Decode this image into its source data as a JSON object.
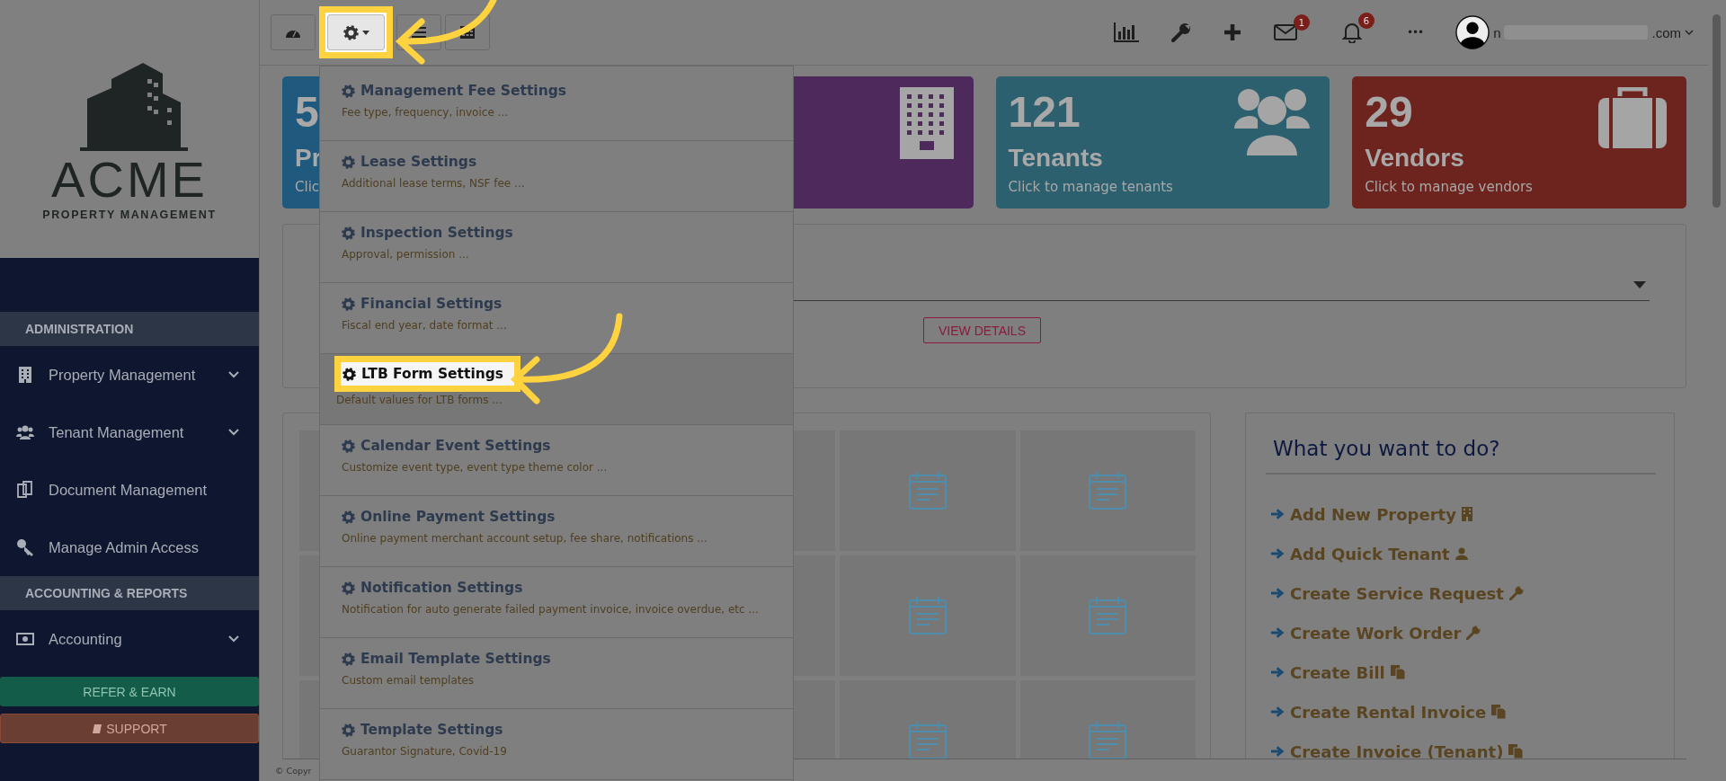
{
  "logo": {
    "name": "ACME",
    "tagline": "PROPERTY MANAGEMENT"
  },
  "sidebar": {
    "sections": [
      {
        "title": "ADMINISTRATION",
        "items": [
          {
            "label": "Property Management",
            "kind": "building",
            "expandable": true
          },
          {
            "label": "Tenant Management",
            "kind": "users",
            "expandable": true
          },
          {
            "label": "Document Management",
            "kind": "documents",
            "expandable": false
          },
          {
            "label": "Manage Admin Access",
            "kind": "key",
            "expandable": false
          }
        ]
      },
      {
        "title": "ACCOUNTING & REPORTS",
        "items": [
          {
            "label": "Accounting",
            "kind": "money",
            "expandable": true
          }
        ]
      }
    ],
    "refer_button": "REFER & EARN",
    "support_button": "SUPPORT"
  },
  "toolbar": {
    "buttons": [
      {
        "kind": "dashboard",
        "selected": false
      },
      {
        "kind": "settings",
        "selected": true
      },
      {
        "kind": "list",
        "selected": false
      },
      {
        "kind": "calculator",
        "selected": false
      }
    ]
  },
  "header": {
    "mail_badge": "1",
    "notification_badge": "6",
    "more": "•••",
    "email_start": "n",
    "email_end": ".com"
  },
  "cards": [
    {
      "kind": "properties",
      "number": "5",
      "label": "Pr",
      "subtitle": "Clic",
      "color": "#1f5a7e"
    },
    {
      "kind": "buildings",
      "color": "#4d2a5b"
    },
    {
      "kind": "tenants",
      "number": "121",
      "label": "Tenants",
      "subtitle": "Click to manage tenants",
      "color": "#2c606f"
    },
    {
      "kind": "vendors",
      "number": "29",
      "label": "Vendors",
      "subtitle": "Click to manage vendors",
      "color": "#6e241e"
    }
  ],
  "panel": {
    "view_details": "VIEW DETAILS"
  },
  "settings_menu": [
    {
      "title": "Management Fee Settings",
      "description": "Fee type, frequency, invoice ...",
      "selected": false
    },
    {
      "title": "Lease Settings",
      "description": "Additional lease terms, NSF fee ...",
      "selected": false
    },
    {
      "title": "Inspection Settings",
      "description": "Approval, permission ...",
      "selected": false
    },
    {
      "title": "Financial Settings",
      "description": "Fiscal end year, date format ...",
      "selected": false
    },
    {
      "title": "LTB Form Settings",
      "description": "Default values for LTB forms ...",
      "selected": true
    },
    {
      "title": "Calendar Event Settings",
      "description": "Customize event type, event type theme color ...",
      "selected": false
    },
    {
      "title": "Online Payment Settings",
      "description": "Online payment merchant account setup, fee share, notifications ...",
      "selected": false
    },
    {
      "title": "Notification Settings",
      "description": "Notification for auto generate failed payment invoice, invoice overdue, etc ...",
      "selected": false
    },
    {
      "title": "Email Template Settings",
      "description": "Custom email templates",
      "selected": false
    },
    {
      "title": "Template Settings",
      "description": "Guarantor Signature, Covid-19",
      "selected": false
    }
  ],
  "quick_actions": {
    "title": "What you want to do?",
    "items": [
      {
        "label": "Add New Property",
        "kind": "building"
      },
      {
        "label": "Add Quick Tenant",
        "kind": "user"
      },
      {
        "label": "Create Service Request",
        "kind": "wrench"
      },
      {
        "label": "Create Work Order",
        "kind": "wrench"
      },
      {
        "label": "Create Bill",
        "kind": "copy"
      },
      {
        "label": "Create Rental Invoice",
        "kind": "copy"
      },
      {
        "label": "Create Invoice (Tenant)",
        "kind": "copy"
      }
    ]
  },
  "footer": "© Copyr"
}
